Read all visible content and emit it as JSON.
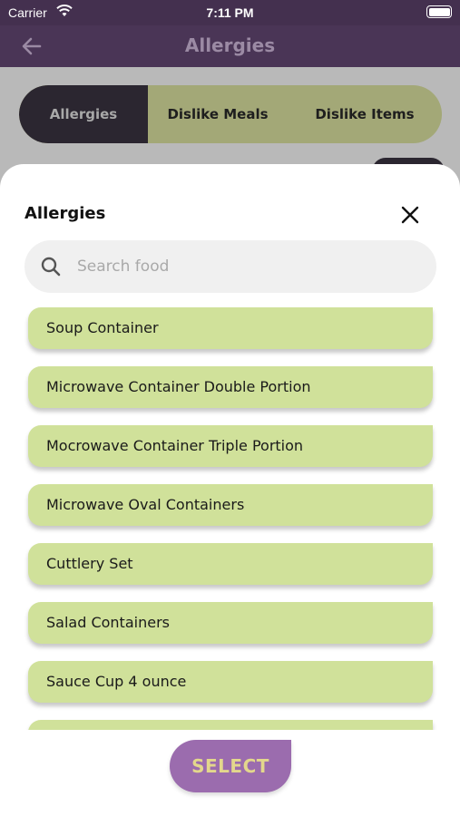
{
  "status_bar": {
    "carrier": "Carrier",
    "time": "7:11 PM"
  },
  "header": {
    "title": "Allergies",
    "back_icon": "arrow-left-icon"
  },
  "tabs": [
    {
      "label": "Allergies",
      "active": true
    },
    {
      "label": "Dislike Meals",
      "active": false
    },
    {
      "label": "Dislike Items",
      "active": false
    }
  ],
  "sheet": {
    "title": "Allergies",
    "close_icon": "close-icon",
    "search": {
      "placeholder": "Search food",
      "value": ""
    },
    "items": [
      {
        "label": "Soup Container"
      },
      {
        "label": "Microwave Container Double Portion"
      },
      {
        "label": "Mocrowave Container Triple Portion"
      },
      {
        "label": "Microwave Oval Containers"
      },
      {
        "label": "Cuttlery Set"
      },
      {
        "label": "Salad Containers"
      },
      {
        "label": "Sauce Cup 4 ounce"
      },
      {
        "label": ""
      }
    ],
    "select_label": "SELECT"
  },
  "colors": {
    "header_bg": "#4a3556",
    "item_bg": "#d0e19a",
    "select_bg": "#9b6cae",
    "select_text": "#e3d78c"
  }
}
